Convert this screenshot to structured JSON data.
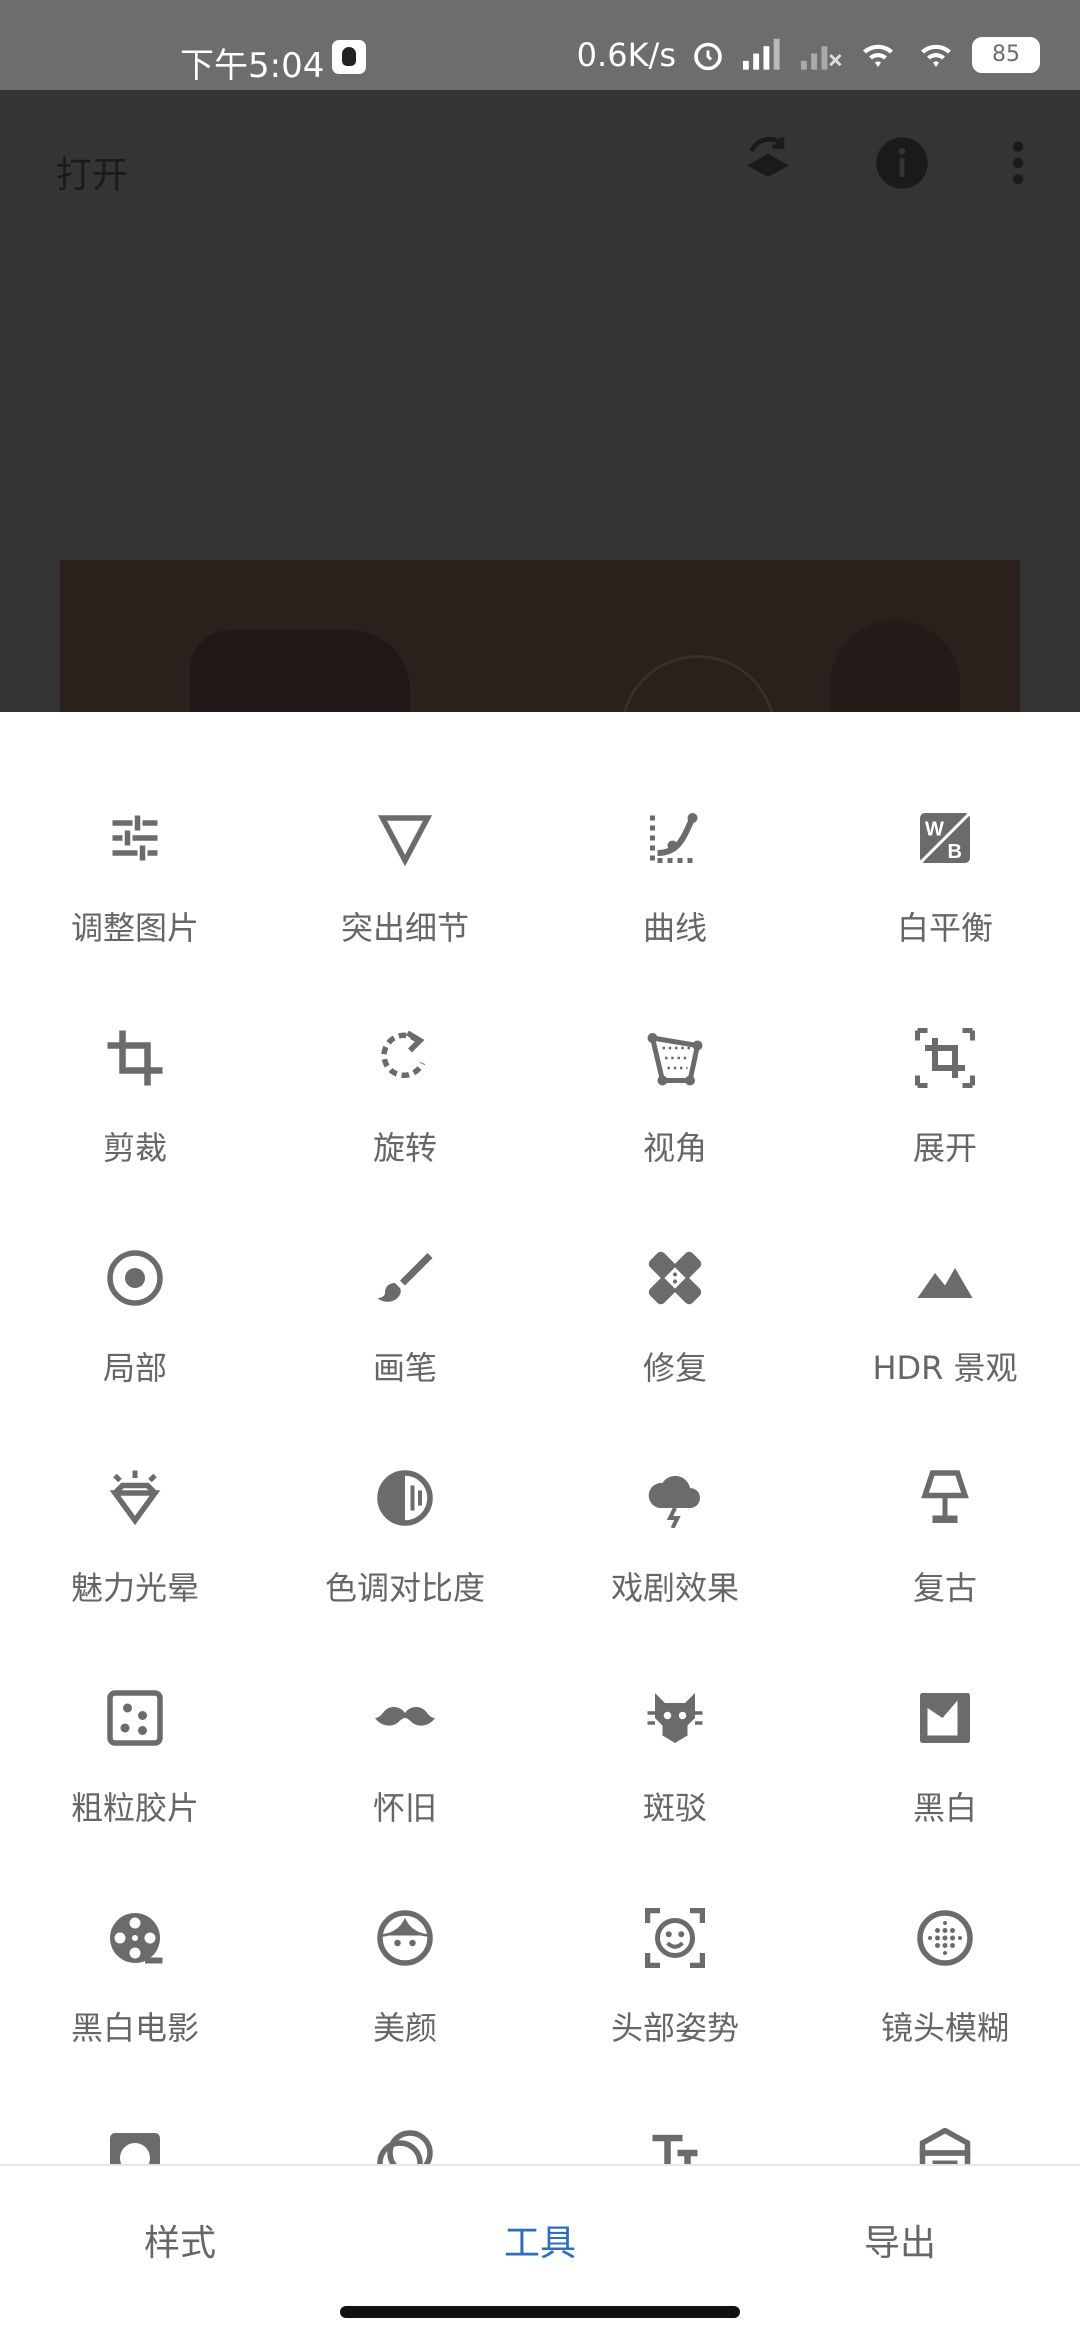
{
  "status_bar": {
    "time": "下午5:04",
    "speed": "0.6K/s",
    "battery": "85"
  },
  "header": {
    "open_label": "打开"
  },
  "tools": [
    {
      "label": "调整图片",
      "icon": "tune-icon"
    },
    {
      "label": "突出细节",
      "icon": "details-triangle-icon"
    },
    {
      "label": "曲线",
      "icon": "curves-icon"
    },
    {
      "label": "白平衡",
      "icon": "white-balance-icon"
    },
    {
      "label": "剪裁",
      "icon": "crop-icon"
    },
    {
      "label": "旋转",
      "icon": "rotate-icon"
    },
    {
      "label": "视角",
      "icon": "perspective-icon"
    },
    {
      "label": "展开",
      "icon": "expand-icon"
    },
    {
      "label": "局部",
      "icon": "selective-icon"
    },
    {
      "label": "画笔",
      "icon": "brush-icon"
    },
    {
      "label": "修复",
      "icon": "healing-icon"
    },
    {
      "label": "HDR 景观",
      "icon": "hdr-landscape-icon"
    },
    {
      "label": "魅力光晕",
      "icon": "glamour-glow-icon"
    },
    {
      "label": "色调对比度",
      "icon": "tonal-contrast-icon"
    },
    {
      "label": "戏剧效果",
      "icon": "drama-cloud-icon"
    },
    {
      "label": "复古",
      "icon": "vintage-lamp-icon"
    },
    {
      "label": "粗粒胶片",
      "icon": "grainy-film-icon"
    },
    {
      "label": "怀旧",
      "icon": "mustache-icon"
    },
    {
      "label": "斑驳",
      "icon": "grunge-icon"
    },
    {
      "label": "黑白",
      "icon": "black-white-icon"
    },
    {
      "label": "黑白电影",
      "icon": "film-reel-icon"
    },
    {
      "label": "美颜",
      "icon": "face-icon"
    },
    {
      "label": "头部姿势",
      "icon": "head-pose-icon"
    },
    {
      "label": "镜头模糊",
      "icon": "lens-blur-icon"
    }
  ],
  "bottom_nav": {
    "styles": "样式",
    "tools": "工具",
    "export": "导出"
  },
  "colors": {
    "accent": "#2f6bc1",
    "icon": "#6b6b6b",
    "label": "#666666"
  }
}
